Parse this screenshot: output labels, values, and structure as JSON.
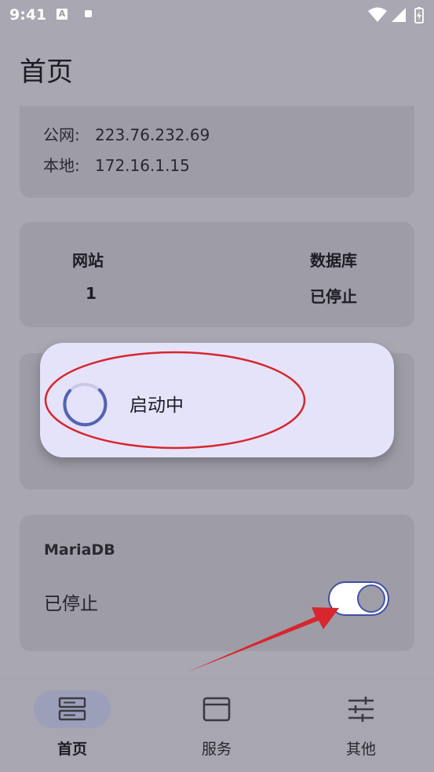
{
  "status_bar": {
    "time": "9:41",
    "icons": [
      "a-notification-icon",
      "square-notification-icon",
      "wifi-icon",
      "signal-icon",
      "battery-charging-icon"
    ]
  },
  "page": {
    "title": "首页"
  },
  "ip_card": {
    "public_label": "公网:",
    "public_ip": "223.76.232.69",
    "local_label": "本地:",
    "local_ip": "172.16.1.15"
  },
  "stats_card": {
    "website_label": "网站",
    "website_value": "1",
    "database_label": "数据库",
    "database_value": "已停止"
  },
  "loading_dialog": {
    "text": "启动中"
  },
  "maria_card": {
    "title": "MariaDB",
    "status": "已停止",
    "switch_on": false
  },
  "nav": {
    "items": [
      {
        "label": "首页",
        "icon": "server-icon",
        "active": true
      },
      {
        "label": "服务",
        "icon": "browser-window-icon",
        "active": false
      },
      {
        "label": "其他",
        "icon": "sliders-icon",
        "active": false
      }
    ]
  },
  "colors": {
    "accent": "#3f4fa3",
    "annotation_red": "#d7262d",
    "dialog_bg": "#e4e3fa"
  }
}
